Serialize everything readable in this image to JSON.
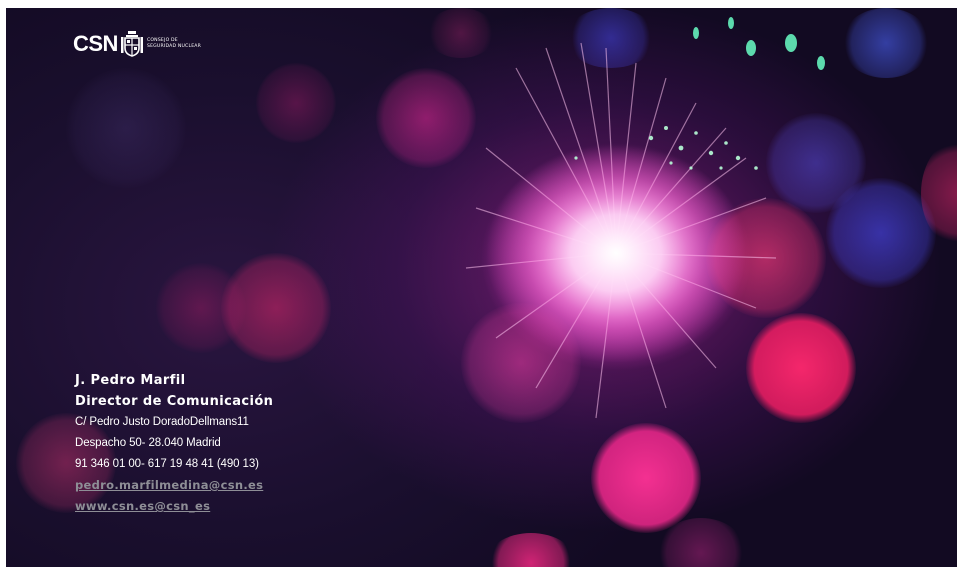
{
  "logo": {
    "name": "CSN",
    "subtitle_line1": "CONSEJO DE",
    "subtitle_line2": "SEGURIDAD NUCLEAR",
    "crest_icon": "coat-of-arms-icon"
  },
  "contact": {
    "name": "J. Pedro Marfil",
    "role": "Director de Comunicación",
    "address_line1": "C/ Pedro Justo DoradoDellmans11",
    "address_line2": "Despacho 50- 28.040 Madrid",
    "phones": "91 346 01 00- 617 19 48 41 (490 13)",
    "email": "pedro.marfilmedina@csn.es",
    "website": "www.csn.es",
    "twitter": "@csn_es"
  },
  "colors": {
    "text": "#ffffff",
    "link": "#8e8e96",
    "background_dark": "#1a0f2e",
    "accent_magenta": "#e8288f"
  }
}
